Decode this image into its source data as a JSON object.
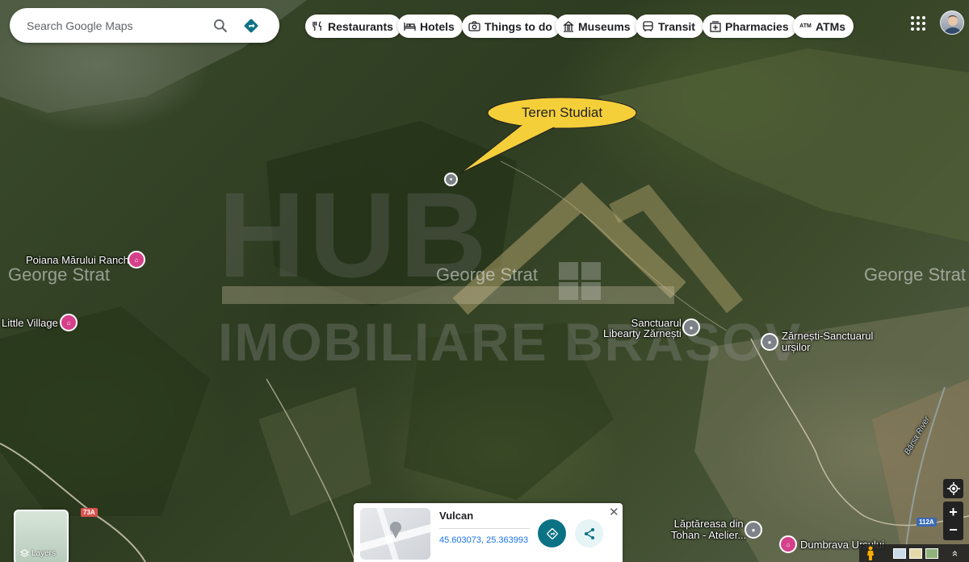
{
  "search": {
    "placeholder": "Search Google Maps",
    "icon": "search-icon",
    "directions_icon": "directions-icon"
  },
  "chips": [
    {
      "label": "Restaurants",
      "icon": "fork-knife-icon"
    },
    {
      "label": "Hotels",
      "icon": "bed-icon"
    },
    {
      "label": "Things to do",
      "icon": "camera-icon"
    },
    {
      "label": "Museums",
      "icon": "museum-icon"
    },
    {
      "label": "Transit",
      "icon": "bus-icon"
    },
    {
      "label": "Pharmacies",
      "icon": "pharmacy-icon"
    },
    {
      "label": "ATMs",
      "icon": "atm-icon"
    }
  ],
  "callout": {
    "text": "Teren Studiat"
  },
  "places": {
    "poiana": "Poiana Mărului Ranch",
    "little_village": "Little Village",
    "sanctuarul_1": "Sanctuarul",
    "sanctuarul_2": "Libearty Zărnești",
    "zarnesti_1": "Zărnești-Sanctuarul",
    "zarnesti_2": "urșilor",
    "laptareasa_1": "Lăptăreasa din",
    "laptareasa_2": "Tohan - Atelier...",
    "dumbrava": "Dumbrava Ursului",
    "barsa": "Bârsa River"
  },
  "roads": {
    "r73a": "73A",
    "r112a": "112A"
  },
  "watermark": {
    "line1": "HUB",
    "line2": "IMOBILIARE BRASOV",
    "agent_left": "George Strat",
    "agent_center": "George Strat",
    "agent_right": "George Strat"
  },
  "card": {
    "title": "Vulcan",
    "coords": "45.603073, 25.363993",
    "close": "✕"
  },
  "layers": {
    "label": "Layers"
  },
  "controls": {
    "zoom_in": "+",
    "zoom_out": "−",
    "expand": "»"
  },
  "colors": {
    "accent": "#0b7285",
    "poi_pink": "#d6408b",
    "callout": "#f5cf3a"
  }
}
